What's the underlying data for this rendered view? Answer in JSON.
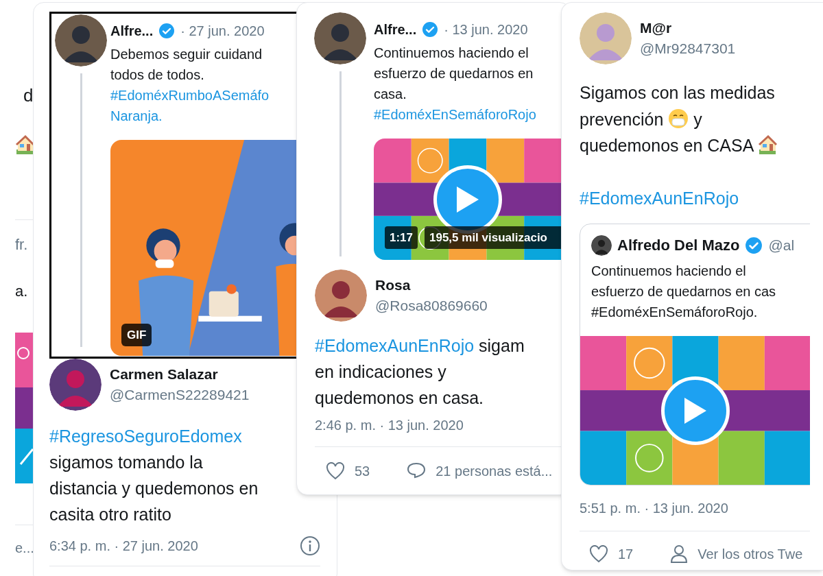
{
  "back_card": {
    "fragments": [
      {
        "text": "d",
        "kind": "body"
      },
      {
        "text": "fr.",
        "kind": "meta"
      },
      {
        "text": "a.",
        "kind": "body"
      },
      {
        "text": "e...",
        "kind": "meta"
      }
    ]
  },
  "card_1": {
    "quoted": {
      "name": "Alfre...",
      "verified": true,
      "date": "· 27 jun. 2020",
      "lines": [
        [
          {
            "text": "Debemos seguir cuidand",
            "kind": "plain"
          }
        ],
        [
          {
            "text": "todos de todos.",
            "kind": "plain"
          }
        ],
        [
          {
            "text": "#EdoméxRumboASemáfo",
            "kind": "hashtag"
          }
        ],
        [
          {
            "text": "Naranja.",
            "kind": "hashtag"
          }
        ]
      ],
      "media": {
        "kind": "gif",
        "badge": "GIF"
      }
    },
    "reply": {
      "name": "Carmen Salazar",
      "handle": "@CarmenS22289421",
      "lines": [
        [
          {
            "text": "#RegresoSeguroEdomex",
            "kind": "hashtag"
          }
        ],
        [
          {
            "text": "sigamos tomando la",
            "kind": "plain"
          }
        ],
        [
          {
            "text": "distancia y quedemonos en",
            "kind": "plain"
          }
        ],
        [
          {
            "text": "casita otro ratito",
            "kind": "plain"
          }
        ]
      ],
      "time": "6:34 p. m. · 27 jun. 2020"
    }
  },
  "card_2": {
    "quoted": {
      "name": "Alfre...",
      "verified": true,
      "date": "· 13 jun. 2020",
      "lines": [
        [
          {
            "text": "Continuemos haciendo el",
            "kind": "plain"
          }
        ],
        [
          {
            "text": "esfuerzo de quedarnos en",
            "kind": "plain"
          }
        ],
        [
          {
            "text": "casa.",
            "kind": "plain"
          }
        ],
        [
          {
            "text": "#EdoméxEnSemáforoRojo",
            "kind": "hashtag"
          }
        ]
      ],
      "media": {
        "kind": "video",
        "duration": "1:17",
        "views": "195,5 mil visualizacio"
      }
    },
    "reply": {
      "name": "Rosa",
      "handle": "@Rosa80869660",
      "lines": [
        [
          {
            "text": "#EdomexAunEnRojo",
            "kind": "hashtag"
          },
          {
            "text": " sigam",
            "kind": "plain"
          }
        ],
        [
          {
            "text": "en indicaciones y",
            "kind": "plain"
          }
        ],
        [
          {
            "text": "quedemonos en casa.",
            "kind": "plain"
          }
        ]
      ],
      "time": "2:46 p. m. · 13 jun. 2020",
      "likes": "53",
      "replies": "21 personas está..."
    }
  },
  "card_3": {
    "tweet": {
      "name": "M@r",
      "handle": "@Mr92847301",
      "lines": [
        [
          {
            "text": "Sigamos con las medidas",
            "kind": "plain"
          }
        ],
        [
          {
            "text": "prevención ",
            "kind": "plain"
          },
          {
            "kind": "mask_emoji"
          },
          {
            "text": " y",
            "kind": "plain"
          }
        ],
        [
          {
            "text": "quedemonos en CASA ",
            "kind": "plain"
          },
          {
            "kind": "house_emoji"
          }
        ]
      ],
      "tag_lines": [
        [
          {
            "text": "#EdomexAunEnRojo",
            "kind": "hashtag"
          }
        ]
      ]
    },
    "quote": {
      "name": "Alfredo Del Mazo",
      "verified": true,
      "handle": "@al",
      "lines": [
        [
          {
            "text": "Continuemos haciendo el",
            "kind": "plain"
          }
        ],
        [
          {
            "text": "esfuerzo de quedarnos en cas",
            "kind": "plain"
          }
        ],
        [
          {
            "text": "#EdoméxEnSemáforoRojo.",
            "kind": "plain"
          }
        ]
      ],
      "media": {
        "kind": "video"
      }
    },
    "time": "5:51 p. m. · 13 jun. 2020",
    "likes": "17",
    "link": "Ver los otros Twe"
  }
}
